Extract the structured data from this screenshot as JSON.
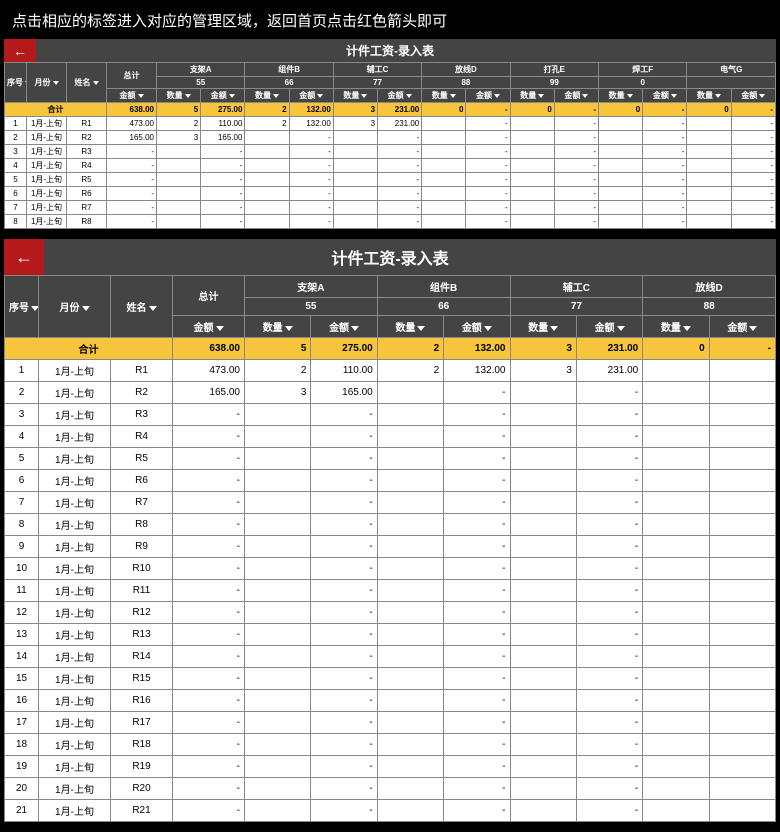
{
  "instruction": "点击相应的标签进入对应的管理区域，返回首页点击红色箭头即可",
  "backArrow": "←",
  "title": "计件工资-录入表",
  "headers": {
    "seq": "序号",
    "month": "月份",
    "name": "姓名",
    "total": "总计",
    "qty": "数量",
    "amt": "金额"
  },
  "categories": [
    {
      "label": "支架A",
      "sub": "55"
    },
    {
      "label": "组件B",
      "sub": "66"
    },
    {
      "label": "辅工C",
      "sub": "77"
    },
    {
      "label": "放线D",
      "sub": "88"
    },
    {
      "label": "打孔E",
      "sub": "99"
    },
    {
      "label": "焊工F",
      "sub": "0"
    },
    {
      "label": "电气G",
      "sub": ""
    }
  ],
  "sumLabel": "合计",
  "sum": {
    "total": "638.00",
    "vals": [
      {
        "q": "5",
        "a": "275.00"
      },
      {
        "q": "2",
        "a": "132.00"
      },
      {
        "q": "3",
        "a": "231.00"
      },
      {
        "q": "0",
        "a": "-"
      },
      {
        "q": "0",
        "a": "-"
      },
      {
        "q": "0",
        "a": "-"
      },
      {
        "q": "0",
        "a": "-"
      }
    ]
  },
  "monthVal": "1月-上旬",
  "rowsSmall": [
    {
      "seq": "1",
      "name": "R1",
      "total": "473.00",
      "vals": [
        {
          "q": "2",
          "a": "110.00"
        },
        {
          "q": "2",
          "a": "132.00"
        },
        {
          "q": "3",
          "a": "231.00"
        },
        {
          "q": "",
          "a": "-"
        },
        {
          "q": "",
          "a": "-"
        },
        {
          "q": "",
          "a": "-"
        },
        {
          "q": "",
          "a": "-"
        }
      ]
    },
    {
      "seq": "2",
      "name": "R2",
      "total": "165.00",
      "vals": [
        {
          "q": "3",
          "a": "165.00"
        },
        {
          "q": "",
          "a": "-"
        },
        {
          "q": "",
          "a": "-"
        },
        {
          "q": "",
          "a": "-"
        },
        {
          "q": "",
          "a": "-"
        },
        {
          "q": "",
          "a": "-"
        },
        {
          "q": "",
          "a": "-"
        }
      ]
    },
    {
      "seq": "3",
      "name": "R3",
      "total": "-",
      "vals": [
        {
          "q": "",
          "a": "-"
        },
        {
          "q": "",
          "a": "-"
        },
        {
          "q": "",
          "a": "-"
        },
        {
          "q": "",
          "a": "-"
        },
        {
          "q": "",
          "a": "-"
        },
        {
          "q": "",
          "a": "-"
        },
        {
          "q": "",
          "a": "-"
        }
      ]
    },
    {
      "seq": "4",
      "name": "R4",
      "total": "-",
      "vals": [
        {
          "q": "",
          "a": "-"
        },
        {
          "q": "",
          "a": "-"
        },
        {
          "q": "",
          "a": "-"
        },
        {
          "q": "",
          "a": "-"
        },
        {
          "q": "",
          "a": "-"
        },
        {
          "q": "",
          "a": "-"
        },
        {
          "q": "",
          "a": "-"
        }
      ]
    },
    {
      "seq": "5",
      "name": "R5",
      "total": "-",
      "vals": [
        {
          "q": "",
          "a": "-"
        },
        {
          "q": "",
          "a": "-"
        },
        {
          "q": "",
          "a": "-"
        },
        {
          "q": "",
          "a": "-"
        },
        {
          "q": "",
          "a": "-"
        },
        {
          "q": "",
          "a": "-"
        },
        {
          "q": "",
          "a": "-"
        }
      ]
    },
    {
      "seq": "6",
      "name": "R6",
      "total": "-",
      "vals": [
        {
          "q": "",
          "a": "-"
        },
        {
          "q": "",
          "a": "-"
        },
        {
          "q": "",
          "a": "-"
        },
        {
          "q": "",
          "a": "-"
        },
        {
          "q": "",
          "a": "-"
        },
        {
          "q": "",
          "a": "-"
        },
        {
          "q": "",
          "a": "-"
        }
      ]
    },
    {
      "seq": "7",
      "name": "R7",
      "total": "-",
      "vals": [
        {
          "q": "",
          "a": "-"
        },
        {
          "q": "",
          "a": "-"
        },
        {
          "q": "",
          "a": "-"
        },
        {
          "q": "",
          "a": "-"
        },
        {
          "q": "",
          "a": "-"
        },
        {
          "q": "",
          "a": "-"
        },
        {
          "q": "",
          "a": "-"
        }
      ]
    },
    {
      "seq": "8",
      "name": "R8",
      "total": "-",
      "vals": [
        {
          "q": "",
          "a": "-"
        },
        {
          "q": "",
          "a": "-"
        },
        {
          "q": "",
          "a": "-"
        },
        {
          "q": "",
          "a": "-"
        },
        {
          "q": "",
          "a": "-"
        },
        {
          "q": "",
          "a": "-"
        },
        {
          "q": "",
          "a": "-"
        }
      ]
    }
  ],
  "rowsBig": [
    {
      "seq": "1",
      "name": "R1",
      "total": "473.00",
      "vals": [
        {
          "q": "2",
          "a": "110.00"
        },
        {
          "q": "2",
          "a": "132.00"
        },
        {
          "q": "3",
          "a": "231.00"
        },
        {
          "q": "",
          "a": ""
        }
      ]
    },
    {
      "seq": "2",
      "name": "R2",
      "total": "165.00",
      "vals": [
        {
          "q": "3",
          "a": "165.00"
        },
        {
          "q": "",
          "a": "-"
        },
        {
          "q": "",
          "a": "-"
        },
        {
          "q": "",
          "a": ""
        }
      ]
    },
    {
      "seq": "3",
      "name": "R3",
      "total": "-",
      "vals": [
        {
          "q": "",
          "a": "-"
        },
        {
          "q": "",
          "a": "-"
        },
        {
          "q": "",
          "a": "-"
        },
        {
          "q": "",
          "a": ""
        }
      ]
    },
    {
      "seq": "4",
      "name": "R4",
      "total": "-",
      "vals": [
        {
          "q": "",
          "a": "-"
        },
        {
          "q": "",
          "a": "-"
        },
        {
          "q": "",
          "a": "-"
        },
        {
          "q": "",
          "a": ""
        }
      ]
    },
    {
      "seq": "5",
      "name": "R5",
      "total": "-",
      "vals": [
        {
          "q": "",
          "a": "-"
        },
        {
          "q": "",
          "a": "-"
        },
        {
          "q": "",
          "a": "-"
        },
        {
          "q": "",
          "a": ""
        }
      ]
    },
    {
      "seq": "6",
      "name": "R6",
      "total": "-",
      "vals": [
        {
          "q": "",
          "a": "-"
        },
        {
          "q": "",
          "a": "-"
        },
        {
          "q": "",
          "a": "-"
        },
        {
          "q": "",
          "a": ""
        }
      ]
    },
    {
      "seq": "7",
      "name": "R7",
      "total": "-",
      "vals": [
        {
          "q": "",
          "a": "-"
        },
        {
          "q": "",
          "a": "-"
        },
        {
          "q": "",
          "a": "-"
        },
        {
          "q": "",
          "a": ""
        }
      ]
    },
    {
      "seq": "8",
      "name": "R8",
      "total": "-",
      "vals": [
        {
          "q": "",
          "a": "-"
        },
        {
          "q": "",
          "a": "-"
        },
        {
          "q": "",
          "a": "-"
        },
        {
          "q": "",
          "a": ""
        }
      ]
    },
    {
      "seq": "9",
      "name": "R9",
      "total": "-",
      "vals": [
        {
          "q": "",
          "a": "-"
        },
        {
          "q": "",
          "a": "-"
        },
        {
          "q": "",
          "a": "-"
        },
        {
          "q": "",
          "a": ""
        }
      ]
    },
    {
      "seq": "10",
      "name": "R10",
      "total": "-",
      "vals": [
        {
          "q": "",
          "a": "-"
        },
        {
          "q": "",
          "a": "-"
        },
        {
          "q": "",
          "a": "-"
        },
        {
          "q": "",
          "a": ""
        }
      ]
    },
    {
      "seq": "11",
      "name": "R11",
      "total": "-",
      "vals": [
        {
          "q": "",
          "a": "-"
        },
        {
          "q": "",
          "a": "-"
        },
        {
          "q": "",
          "a": "-"
        },
        {
          "q": "",
          "a": ""
        }
      ]
    },
    {
      "seq": "12",
      "name": "R12",
      "total": "-",
      "vals": [
        {
          "q": "",
          "a": "-"
        },
        {
          "q": "",
          "a": "-"
        },
        {
          "q": "",
          "a": "-"
        },
        {
          "q": "",
          "a": ""
        }
      ]
    },
    {
      "seq": "13",
      "name": "R13",
      "total": "-",
      "vals": [
        {
          "q": "",
          "a": "-"
        },
        {
          "q": "",
          "a": "-"
        },
        {
          "q": "",
          "a": "-"
        },
        {
          "q": "",
          "a": ""
        }
      ]
    },
    {
      "seq": "14",
      "name": "R14",
      "total": "-",
      "vals": [
        {
          "q": "",
          "a": "-"
        },
        {
          "q": "",
          "a": "-"
        },
        {
          "q": "",
          "a": "-"
        },
        {
          "q": "",
          "a": ""
        }
      ]
    },
    {
      "seq": "15",
      "name": "R15",
      "total": "-",
      "vals": [
        {
          "q": "",
          "a": "-"
        },
        {
          "q": "",
          "a": "-"
        },
        {
          "q": "",
          "a": "-"
        },
        {
          "q": "",
          "a": ""
        }
      ]
    },
    {
      "seq": "16",
      "name": "R16",
      "total": "-",
      "vals": [
        {
          "q": "",
          "a": "-"
        },
        {
          "q": "",
          "a": "-"
        },
        {
          "q": "",
          "a": "-"
        },
        {
          "q": "",
          "a": ""
        }
      ]
    },
    {
      "seq": "17",
      "name": "R17",
      "total": "-",
      "vals": [
        {
          "q": "",
          "a": "-"
        },
        {
          "q": "",
          "a": "-"
        },
        {
          "q": "",
          "a": "-"
        },
        {
          "q": "",
          "a": ""
        }
      ]
    },
    {
      "seq": "18",
      "name": "R18",
      "total": "-",
      "vals": [
        {
          "q": "",
          "a": "-"
        },
        {
          "q": "",
          "a": "-"
        },
        {
          "q": "",
          "a": "-"
        },
        {
          "q": "",
          "a": ""
        }
      ]
    },
    {
      "seq": "19",
      "name": "R19",
      "total": "-",
      "vals": [
        {
          "q": "",
          "a": "-"
        },
        {
          "q": "",
          "a": "-"
        },
        {
          "q": "",
          "a": "-"
        },
        {
          "q": "",
          "a": ""
        }
      ]
    },
    {
      "seq": "20",
      "name": "R20",
      "total": "-",
      "vals": [
        {
          "q": "",
          "a": "-"
        },
        {
          "q": "",
          "a": "-"
        },
        {
          "q": "",
          "a": "-"
        },
        {
          "q": "",
          "a": ""
        }
      ]
    },
    {
      "seq": "21",
      "name": "R21",
      "total": "-",
      "vals": [
        {
          "q": "",
          "a": "-"
        },
        {
          "q": "",
          "a": "-"
        },
        {
          "q": "",
          "a": "-"
        },
        {
          "q": "",
          "a": ""
        }
      ]
    }
  ]
}
